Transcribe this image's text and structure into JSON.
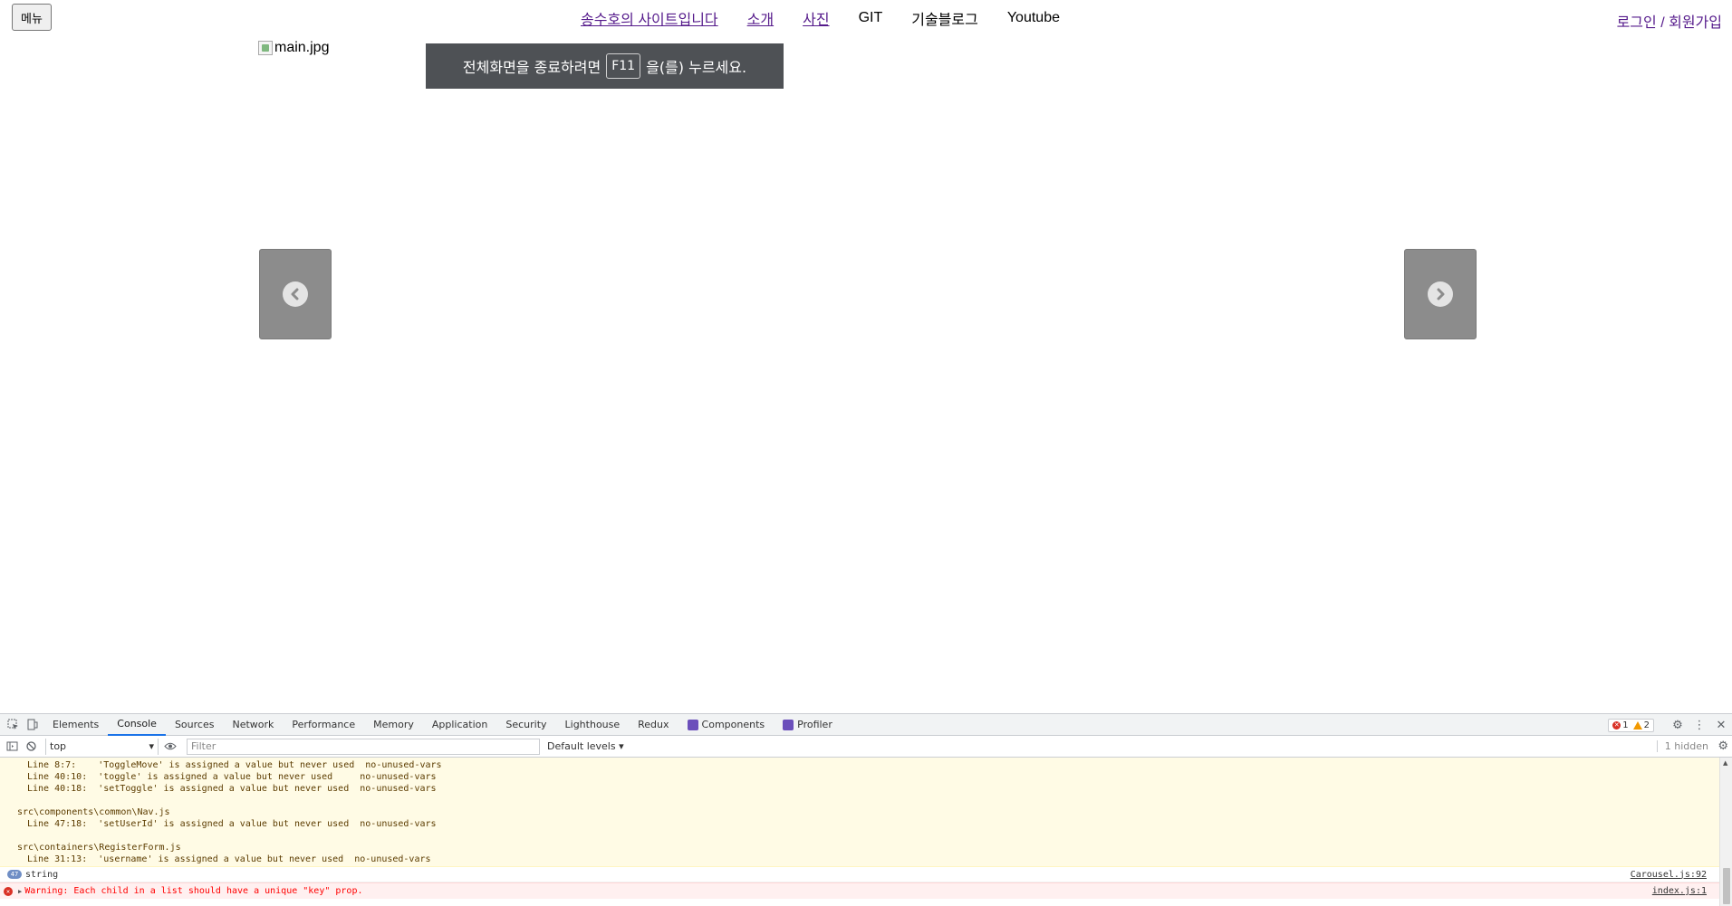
{
  "page": {
    "menu_button": "메뉴",
    "nav_links": [
      {
        "label": "송수호의 사이트입니다",
        "style": "link"
      },
      {
        "label": "소개",
        "style": "link"
      },
      {
        "label": "사진",
        "style": "link"
      },
      {
        "label": "GIT",
        "style": "plain"
      },
      {
        "label": "기술블로그",
        "style": "plain"
      },
      {
        "label": "Youtube",
        "style": "plain"
      }
    ],
    "auth": {
      "login": "로그인",
      "separator": "/",
      "register": "회원가입"
    },
    "main_image_alt": "main.jpg",
    "fullscreen_toast": {
      "prefix": "전체화면을 종료하려면",
      "key": "F11",
      "suffix": "을(를) 누르세요."
    },
    "carousel": {
      "prev_icon": "chevron-left-circle-icon",
      "next_icon": "chevron-right-circle-icon"
    },
    "colors": {
      "visited_link": "#551a8b",
      "toast_bg": "#4e5155",
      "arrow_bg": "#8c8c8c"
    }
  },
  "devtools": {
    "tabs": [
      "Elements",
      "Console",
      "Sources",
      "Network",
      "Performance",
      "Memory",
      "Application",
      "Security",
      "Lighthouse",
      "Redux",
      "Components",
      "Profiler"
    ],
    "active_tab": "Console",
    "extension_tabs": [
      "Components",
      "Profiler"
    ],
    "error_count": "1",
    "warning_count": "2",
    "context": "top",
    "filter_placeholder": "Filter",
    "levels": "Default levels ▾",
    "hidden": "1 hidden",
    "warnings": [
      {
        "type": "line",
        "text": "Line 8:7:    'ToggleMove' is assigned a value but never used  no-unused-vars"
      },
      {
        "type": "line",
        "text": "Line 40:10:  'toggle' is assigned a value but never used     no-unused-vars"
      },
      {
        "type": "line",
        "text": "Line 40:18:  'setToggle' is assigned a value but never used  no-unused-vars"
      },
      {
        "type": "gap",
        "text": ""
      },
      {
        "type": "file",
        "text": "src\\components\\common\\Nav.js"
      },
      {
        "type": "line",
        "text": "Line 47:18:  'setUserId' is assigned a value but never used  no-unused-vars"
      },
      {
        "type": "gap",
        "text": ""
      },
      {
        "type": "file",
        "text": "src\\containers\\RegisterForm.js"
      },
      {
        "type": "line",
        "text": "Line 31:13:  'username' is assigned a value but never used  no-unused-vars"
      }
    ],
    "log": {
      "count": "47",
      "text": "string",
      "source": "Carousel.js:92"
    },
    "error": {
      "text": "Warning: Each child in a list should have a unique \"key\" prop.",
      "source": "index.js:1"
    }
  }
}
